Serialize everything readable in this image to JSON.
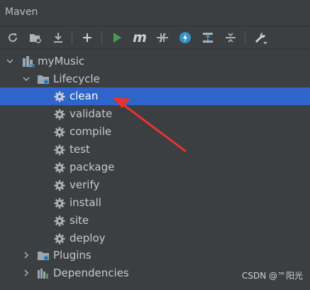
{
  "window": {
    "title": "Maven"
  },
  "toolbar": {
    "buttons": [
      {
        "name": "reload-icon"
      },
      {
        "name": "add-maven-project-icon"
      },
      {
        "name": "download-sources-icon"
      },
      {
        "name": "add-icon"
      },
      {
        "name": "run-icon"
      },
      {
        "name": "execute-goal-icon"
      },
      {
        "name": "toggle-offline-icon"
      },
      {
        "name": "skip-tests-icon"
      },
      {
        "name": "show-dependencies-icon"
      },
      {
        "name": "collapse-all-icon"
      },
      {
        "name": "settings-wrench-icon"
      }
    ],
    "execute_goal_glyph": "m"
  },
  "tree": {
    "project": {
      "label": "myMusic"
    },
    "lifecycle": {
      "label": "Lifecycle",
      "goals": [
        "clean",
        "validate",
        "compile",
        "test",
        "package",
        "verify",
        "install",
        "site",
        "deploy"
      ],
      "selected": "clean"
    },
    "plugins": {
      "label": "Plugins"
    },
    "dependencies": {
      "label": "Dependencies"
    }
  },
  "watermark": "CSDN @™阳光",
  "colors": {
    "background": "#3c3f41",
    "selection": "#2f65ca",
    "run_green": "#499c54",
    "annotation_arrow": "#e8322f"
  }
}
